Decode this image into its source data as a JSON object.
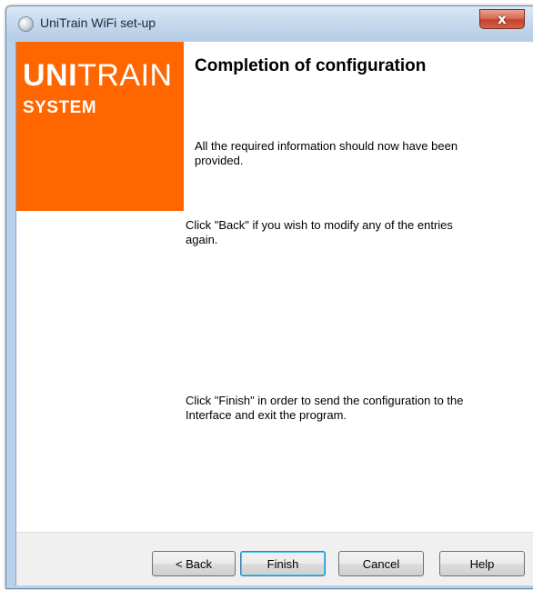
{
  "window": {
    "title": "UniTrain WiFi set-up",
    "close_label": "x"
  },
  "brand": {
    "main_bold": "UNI",
    "main_regular": "TRAIN",
    "sub": "SYSTEM"
  },
  "content": {
    "heading": "Completion of configuration",
    "paragraph1": "All the required information should now have been provided.",
    "paragraph2": "Click \"Back\" if you wish to modify any of the entries again.",
    "paragraph3": "Click \"Finish\" in order to send the configuration to the Interface and exit the program."
  },
  "buttons": {
    "back": "< Back",
    "finish": "Finish",
    "cancel": "Cancel",
    "help": "Help"
  },
  "colors": {
    "brand": "#ff6600",
    "title_bar": "#c4d8ee",
    "close_button": "#c2422c"
  }
}
